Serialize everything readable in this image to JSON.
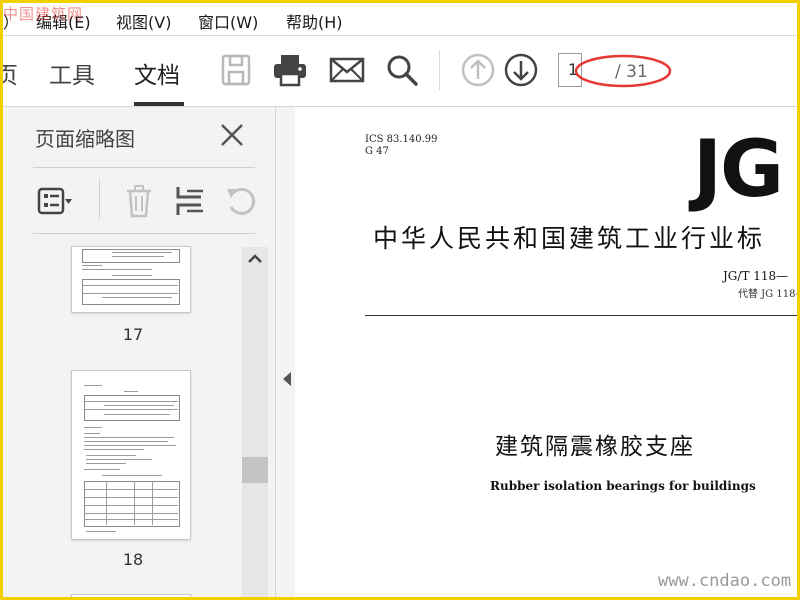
{
  "watermark_top_left": "中国建筑网",
  "watermark_bottom_right": "www.cndao.com",
  "menu": {
    "cut_item": "）",
    "edit": "编辑(E)",
    "view": "视图(V)",
    "window": "窗口(W)",
    "help": "帮助(H)"
  },
  "toolbar": {
    "tab_home_partial": "页",
    "tab_tools": "工具",
    "tab_document": "文档",
    "save_icon": "floppy-disk-icon",
    "print_icon": "printer-icon",
    "email_icon": "envelope-icon",
    "search_icon": "magnifier-icon",
    "prev_page_icon": "arrow-up-circle-icon",
    "next_page_icon": "arrow-down-circle-icon",
    "page_number": "1",
    "page_total": "/ 31",
    "highlight_color": "#e53935"
  },
  "panel": {
    "title": "页面缩略图",
    "close_icon": "close-icon",
    "options_icon": "thumbnail-options-icon",
    "delete_icon": "trash-icon",
    "extract_icon": "extract-pages-icon",
    "rotate_icon": "rotate-icon",
    "thumbnails": [
      {
        "label": "17"
      },
      {
        "label": "18"
      }
    ]
  },
  "document": {
    "ics": "ICS 83.140.99",
    "g": "G 47",
    "logo": "JG",
    "standard_title": "中华人民共和国建筑工业行业标",
    "standard_number": "JG/T 118—",
    "replaces": "代替 JG 118-",
    "title_cn": "建筑隔震橡胶支座",
    "title_en": "Rubber isolation bearings for buildings"
  }
}
